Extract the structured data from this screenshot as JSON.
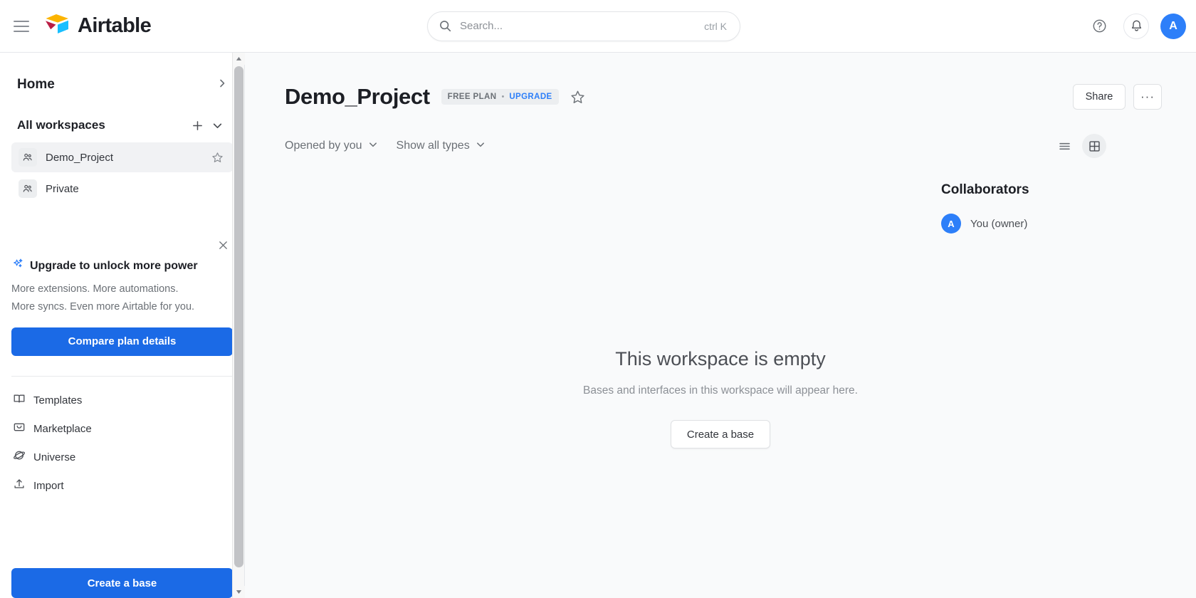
{
  "topbar": {
    "menu_icon": "hamburger-menu-icon",
    "brand_name": "Airtable",
    "brand_logo_icon": "airtable-logo-icon",
    "search": {
      "icon": "search-icon",
      "placeholder": "Search...",
      "value": "",
      "shortcut": "ctrl K"
    },
    "help_icon": "help-circle-icon",
    "notifications_icon": "bell-icon",
    "avatar_initial": "A"
  },
  "sidebar": {
    "home": {
      "label": "Home",
      "chevron_icon": "chevron-right-icon"
    },
    "workspaces_section": {
      "label": "All workspaces",
      "add_icon": "plus-icon",
      "collapse_icon": "chevron-down-icon"
    },
    "workspaces": [
      {
        "name": "Demo_Project",
        "icon": "workspace-people-icon",
        "star_icon": "star-outline-icon",
        "active": true
      },
      {
        "name": "Private",
        "icon": "workspace-people-icon",
        "star_icon": "",
        "active": false
      }
    ],
    "upgrade_card": {
      "close_icon": "close-icon",
      "sparkle_icon": "sparkle-icon",
      "title": "Upgrade to unlock more power",
      "description_line1": "More extensions. More automations.",
      "description_line2": "More syncs. Even more Airtable for you.",
      "button_label": "Compare plan details"
    },
    "nav_items": [
      {
        "label": "Templates",
        "icon": "book-icon"
      },
      {
        "label": "Marketplace",
        "icon": "marketplace-box-icon"
      },
      {
        "label": "Universe",
        "icon": "planet-icon"
      },
      {
        "label": "Import",
        "icon": "upload-icon"
      }
    ],
    "create_base_label": "Create a base",
    "scrollbar": {
      "up_icon": "scroll-up-arrow-icon",
      "down_icon": "scroll-down-arrow-icon"
    }
  },
  "main": {
    "title": "Demo_Project",
    "plan_badge": {
      "plan": "FREE PLAN",
      "separator": "•",
      "upgrade": "UPGRADE"
    },
    "favorite_icon": "star-outline-icon",
    "share_label": "Share",
    "more_label": "···",
    "filters": [
      {
        "label": "Opened by you",
        "chevron_icon": "chevron-down-icon"
      },
      {
        "label": "Show all types",
        "chevron_icon": "chevron-down-icon"
      }
    ],
    "view_toggle": {
      "list_icon": "list-view-icon",
      "grid_icon": "grid-view-icon",
      "active": "grid"
    },
    "collaborators": {
      "title": "Collaborators",
      "members": [
        {
          "initial": "A",
          "name": "You (owner)"
        }
      ]
    },
    "empty_state": {
      "title": "This workspace is empty",
      "subtitle": "Bases and interfaces in this workspace will appear here.",
      "button_label": "Create a base"
    }
  },
  "colors": {
    "brand_blue": "#2d7ff9",
    "primary_button": "#1b6ae6",
    "logo_yellow": "#fcb400",
    "logo_red": "#ba1e45",
    "logo_blue": "#18bfff",
    "main_bg": "#f9fafb"
  }
}
